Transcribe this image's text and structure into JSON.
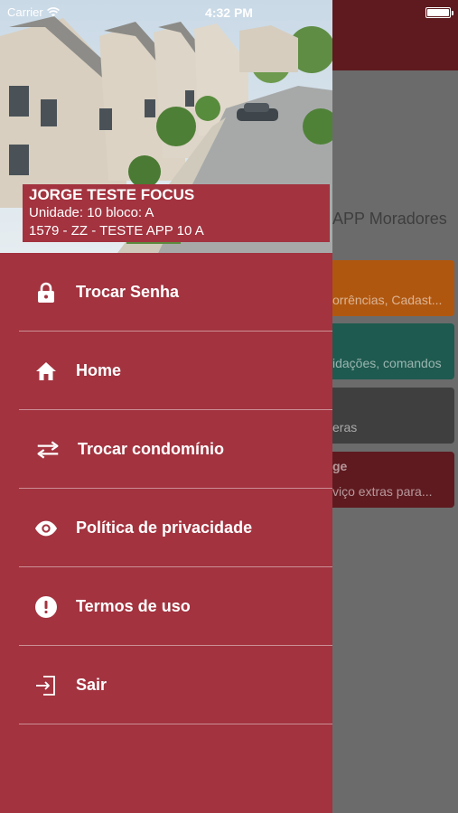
{
  "status_bar": {
    "carrier": "Carrier",
    "time": "4:32 PM"
  },
  "background": {
    "title": "APP Moradores",
    "cards": [
      {
        "title": "",
        "subtitle": "orrências, Cadast...",
        "color": "#b0570f"
      },
      {
        "title": "",
        "subtitle": "idações, comandos",
        "color": "#1e5a4f"
      },
      {
        "title": "",
        "subtitle": "eras",
        "color": "#3f3f3f"
      },
      {
        "title": "ge",
        "subtitle": "viço extras para...",
        "color": "#5e1a1f"
      }
    ]
  },
  "drawer": {
    "accent": "#a2333f",
    "user": {
      "name": "JORGE TESTE FOCUS",
      "unit": "Unidade: 10 bloco: A",
      "condo": "1579 - ZZ - TESTE APP 10 A"
    },
    "menu": [
      {
        "label": "Trocar Senha",
        "icon": "lock-icon"
      },
      {
        "label": "Home",
        "icon": "home-icon"
      },
      {
        "label": "Trocar condomínio",
        "icon": "swap-icon"
      },
      {
        "label": "Política de privacidade",
        "icon": "eye-icon"
      },
      {
        "label": "Termos de uso",
        "icon": "alert-circle-icon"
      },
      {
        "label": "Sair",
        "icon": "logout-icon"
      }
    ]
  }
}
